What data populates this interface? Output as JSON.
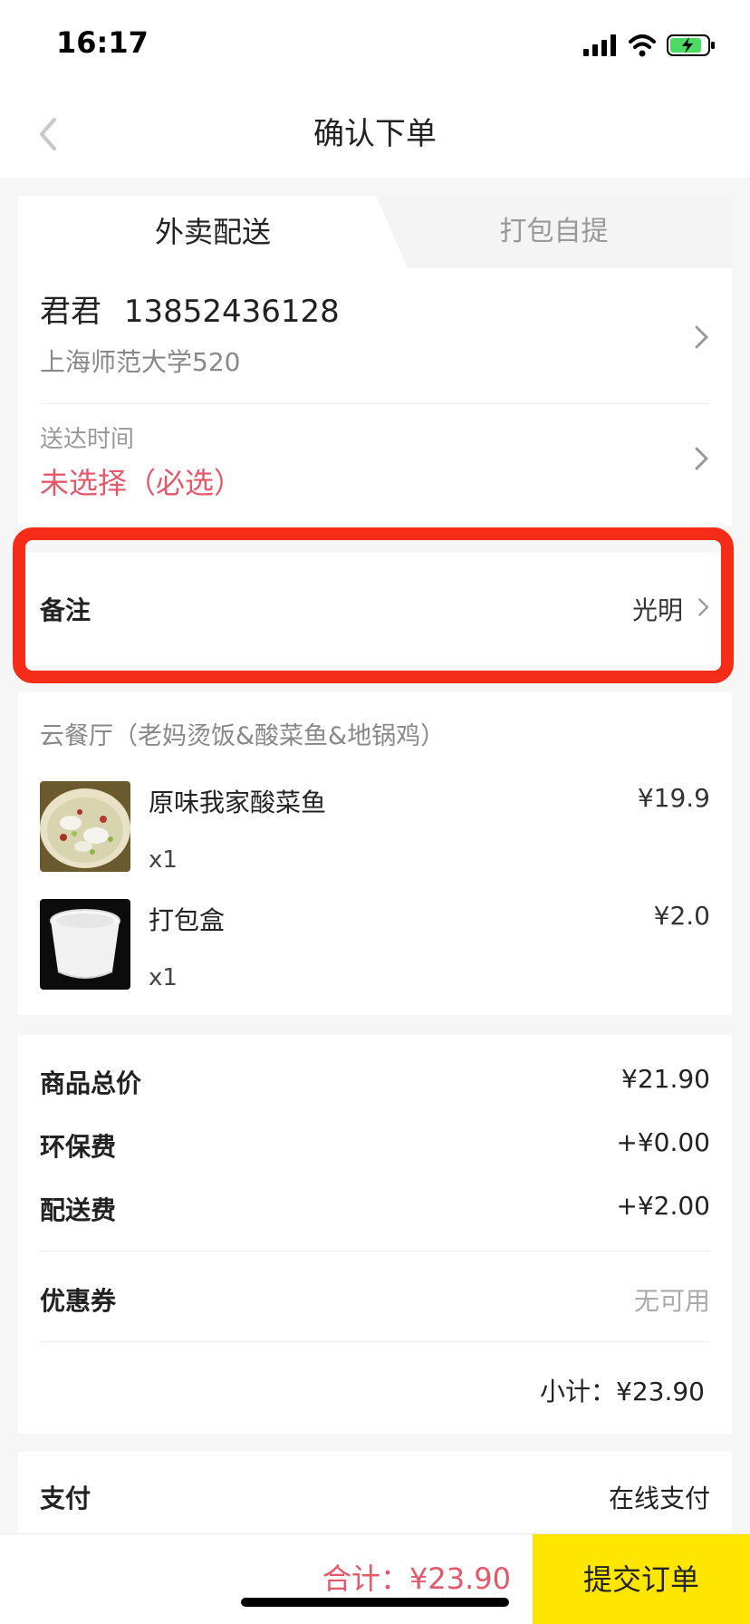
{
  "status_bar": {
    "time": "16:17"
  },
  "nav": {
    "title": "确认下单"
  },
  "tabs": [
    {
      "label": "外卖配送",
      "active": true
    },
    {
      "label": "打包自提",
      "active": false
    }
  ],
  "address": {
    "name": "君君",
    "phone": "13852436128",
    "line": "上海师范大学520"
  },
  "delivery_time": {
    "label": "送达时间",
    "value": "未选择（必选）"
  },
  "note": {
    "label": "备注",
    "value": "光明"
  },
  "shop": {
    "name": "云餐厅（老妈烫饭&酸菜鱼&地锅鸡）"
  },
  "items": [
    {
      "name": "原味我家酸菜鱼",
      "qty": "x1",
      "price": "¥19.9",
      "icon": "pickled-fish-dish"
    },
    {
      "name": "打包盒",
      "qty": "x1",
      "price": "¥2.0",
      "icon": "takeout-box"
    }
  ],
  "fees": [
    {
      "label": "商品总价",
      "value": "¥21.90"
    },
    {
      "label": "环保费",
      "value": "+¥0.00"
    },
    {
      "label": "配送费",
      "value": "+¥2.00"
    }
  ],
  "coupon": {
    "label": "优惠券",
    "value": "无可用"
  },
  "subtotal": "小计：¥23.90",
  "payment": {
    "label": "支付",
    "value": "在线支付"
  },
  "bottom": {
    "total": "合计：¥23.90",
    "submit": "提交订单"
  },
  "colors": {
    "accent_red": "#e5586a",
    "highlight": "#f52d18",
    "button_yellow": "#ffe600"
  }
}
